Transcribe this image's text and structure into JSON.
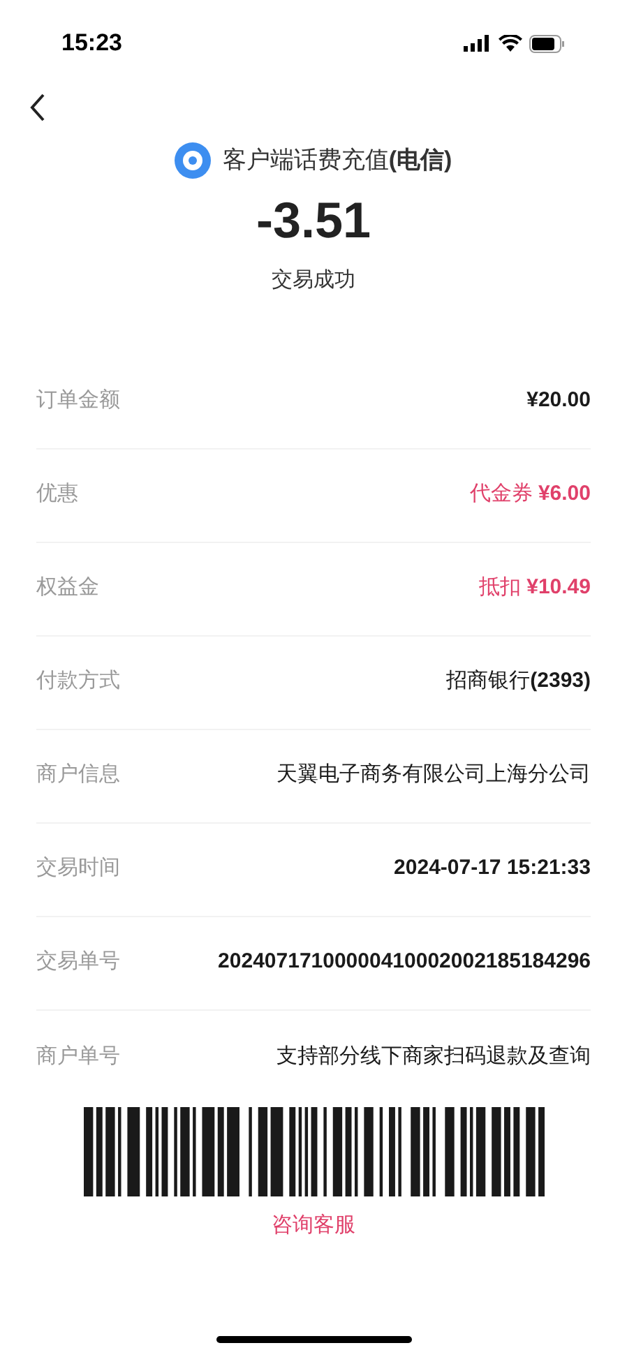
{
  "status_bar": {
    "time": "15:23"
  },
  "header": {
    "merchant": "客户端话费充值**(电信)**",
    "amount": "-3.51",
    "status": "交易成功"
  },
  "details": [
    {
      "label": "订单金额",
      "value": "¥20.00",
      "kind": "bold"
    },
    {
      "label": "优惠",
      "value": "代金券 **¥6.00**",
      "kind": "discount"
    },
    {
      "label": "权益金",
      "value": "抵扣 **¥10.49**",
      "kind": "discount"
    },
    {
      "label": "付款方式",
      "value": "招商银行**(2393)**",
      "kind": "plain"
    },
    {
      "label": "商户信息",
      "value": "天翼电子商务有限公司上海分公司",
      "kind": "plain"
    },
    {
      "label": "交易时间",
      "value": "2024-07-17 15:21:33",
      "kind": "bold"
    },
    {
      "label": "交易单号",
      "value": "20240717100000410002002185184296",
      "kind": "bold"
    },
    {
      "label": "商户单号",
      "value": "支持部分线下商家扫码退款及查询",
      "kind": "plain"
    }
  ],
  "support_link": "咨询客服"
}
